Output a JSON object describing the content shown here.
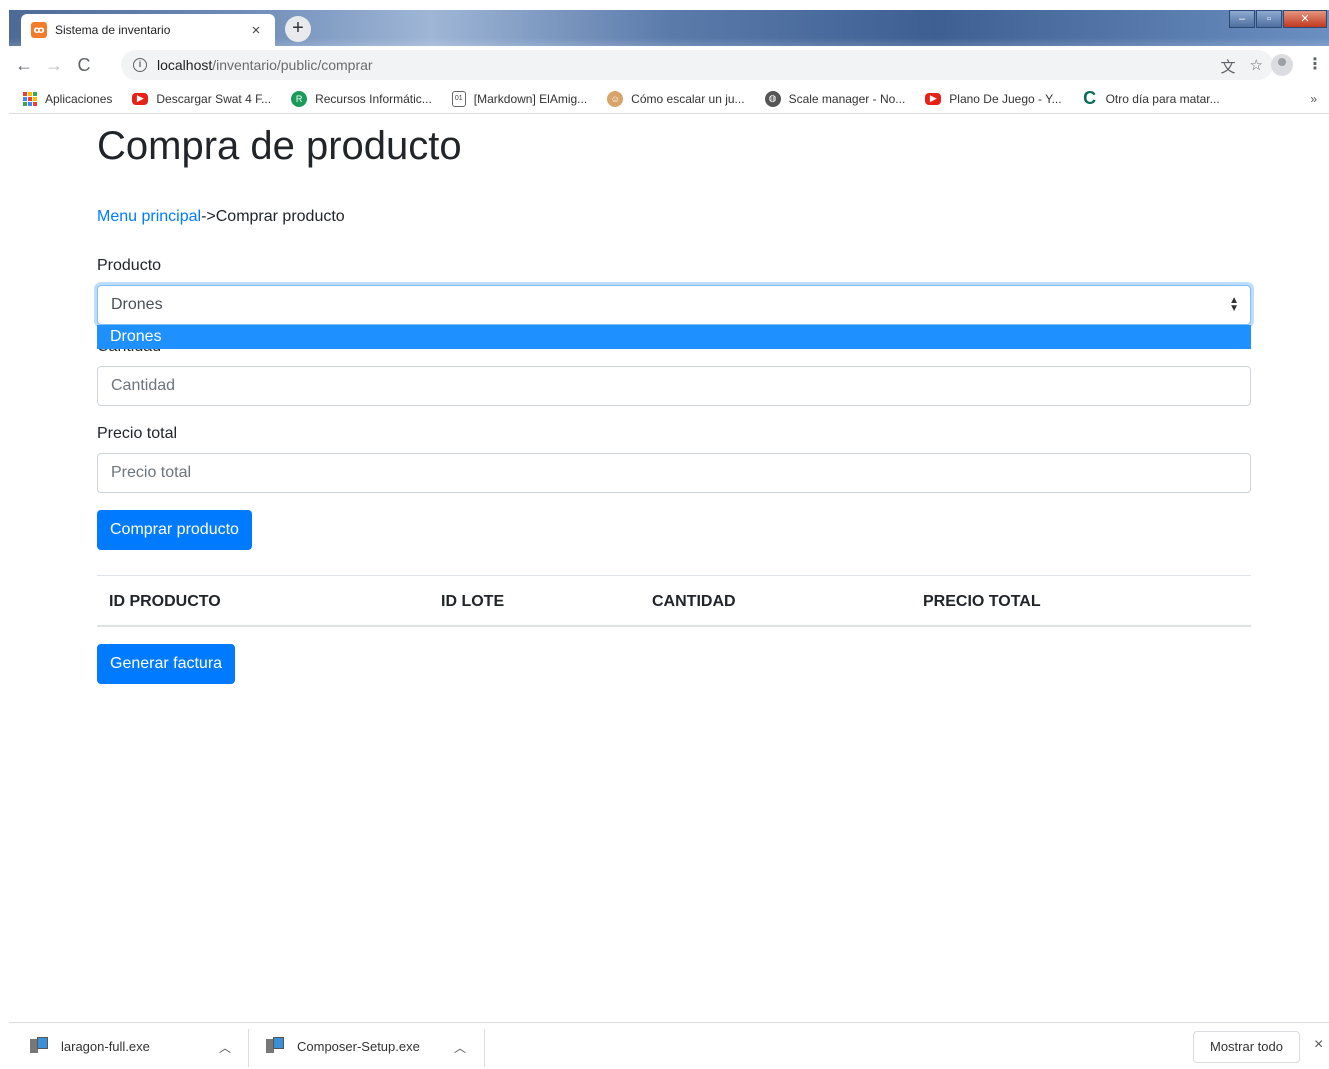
{
  "browser": {
    "tab_title": "Sistema de inventario",
    "tab_close": "×",
    "new_tab": "+",
    "url_host": "localhost",
    "url_path": "/inventario/public/comprar",
    "bookmarks": [
      {
        "icon": "apps-grid-icon",
        "label": "Aplicaciones"
      },
      {
        "icon": "youtube-icon",
        "label": "Descargar Swat 4 F..."
      },
      {
        "icon": "recursos-icon",
        "label": "Recursos Informátic..."
      },
      {
        "icon": "document-icon",
        "label": "[Markdown] ElAmig..."
      },
      {
        "icon": "face-icon",
        "label": "Cómo escalar un ju..."
      },
      {
        "icon": "globe-icon",
        "label": "Scale manager - No..."
      },
      {
        "icon": "youtube-icon",
        "label": "Plano De Juego - Y..."
      },
      {
        "icon": "c-logo-icon",
        "label": "Otro día para matar..."
      }
    ],
    "bookmarks_more": "»"
  },
  "page": {
    "title": "Compra de producto",
    "breadcrumb": {
      "link": "Menu principal",
      "separator": "->",
      "current": "Comprar producto"
    },
    "producto": {
      "label": "Producto",
      "selected": "Drones",
      "options": [
        "Drones"
      ],
      "highlighted_option": "Drones"
    },
    "cantidad": {
      "label": "Cantidad",
      "placeholder": "Cantidad"
    },
    "precio_total": {
      "label": "Precio total",
      "placeholder": "Precio total"
    },
    "buy_button": "Comprar producto",
    "table_headers": [
      "ID PRODUCTO",
      "ID LOTE",
      "CANTIDAD",
      "PRECIO TOTAL"
    ],
    "invoice_button": "Generar factura"
  },
  "downloads": {
    "items": [
      {
        "name": "laragon-full.exe"
      },
      {
        "name": "Composer-Setup.exe"
      }
    ],
    "show_all": "Mostrar todo",
    "close": "×"
  },
  "colors": {
    "primary": "#007bff",
    "dropdown_highlight": "#1e90ff",
    "link": "#007bff"
  }
}
